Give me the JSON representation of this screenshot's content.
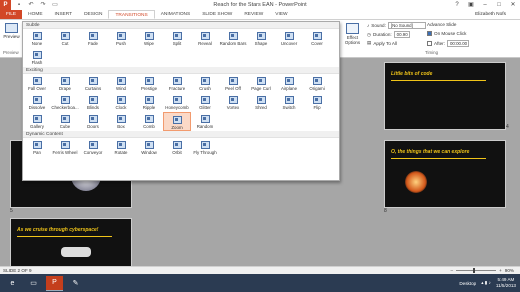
{
  "window": {
    "title": "Reach for the Stars EAN - PowerPoint",
    "app_icon": "P"
  },
  "tabs": [
    "FILE",
    "HOME",
    "INSERT",
    "DESIGN",
    "TRANSITIONS",
    "ANIMATIONS",
    "SLIDE SHOW",
    "REVIEW",
    "VIEW"
  ],
  "user": "Elizabeth Nofs",
  "ribbon": {
    "preview_label": "Preview",
    "preview_group": "Preview",
    "effect_options": "Effect Options",
    "timing": {
      "sound_label": "Sound:",
      "sound_value": "[No Sound]",
      "duration_label": "Duration:",
      "duration_value": "00.90",
      "apply_all": "Apply To All",
      "advance_label": "Advance Slide",
      "on_click": "On Mouse Click",
      "after_label": "After:",
      "after_value": "00:00.00",
      "group": "Timing"
    }
  },
  "gallery": {
    "sections": [
      {
        "name": "Subtle",
        "items": [
          "None",
          "Cut",
          "Fade",
          "Push",
          "Wipe",
          "Split",
          "Reveal",
          "Random Bars",
          "Shape",
          "Uncover",
          "Cover",
          "Flash"
        ]
      },
      {
        "name": "Exciting",
        "items": [
          "Fall Over",
          "Drape",
          "Curtains",
          "Wind",
          "Prestige",
          "Fracture",
          "Crush",
          "Peel Off",
          "Page Curl",
          "Airplane",
          "Origami",
          "Dissolve",
          "Checkerboa...",
          "Blinds",
          "Clock",
          "Ripple",
          "Honeycomb",
          "Glitter",
          "Vortex",
          "Shred",
          "Switch",
          "Flip",
          "Gallery",
          "Cube",
          "Doors",
          "Box",
          "Comb",
          "Zoom",
          "Random"
        ]
      },
      {
        "name": "Dynamic Content",
        "items": [
          "Pan",
          "Ferris Wheel",
          "Conveyor",
          "Rotate",
          "Window",
          "Orbit",
          "Fly Through"
        ]
      }
    ],
    "selected": "Zoom"
  },
  "slides": {
    "s4_title": "Little bits of code",
    "s8_title": "O, the things that we can explore",
    "s9_title": "As we cruise through cyberspace!",
    "numbers": [
      "4",
      "5",
      "8",
      "9"
    ]
  },
  "status": {
    "slide": "SLIDE 2 OF 9",
    "zoom": "90%",
    "zoom_fraction": 0.9
  },
  "taskbar": {
    "desktop": "Desktop",
    "time": "5:49 AM",
    "date": "11/5/2013"
  },
  "colors": {
    "accent": "#d24726",
    "selected_fill": "#fbd9c7",
    "slide_text": "#f0c419"
  }
}
